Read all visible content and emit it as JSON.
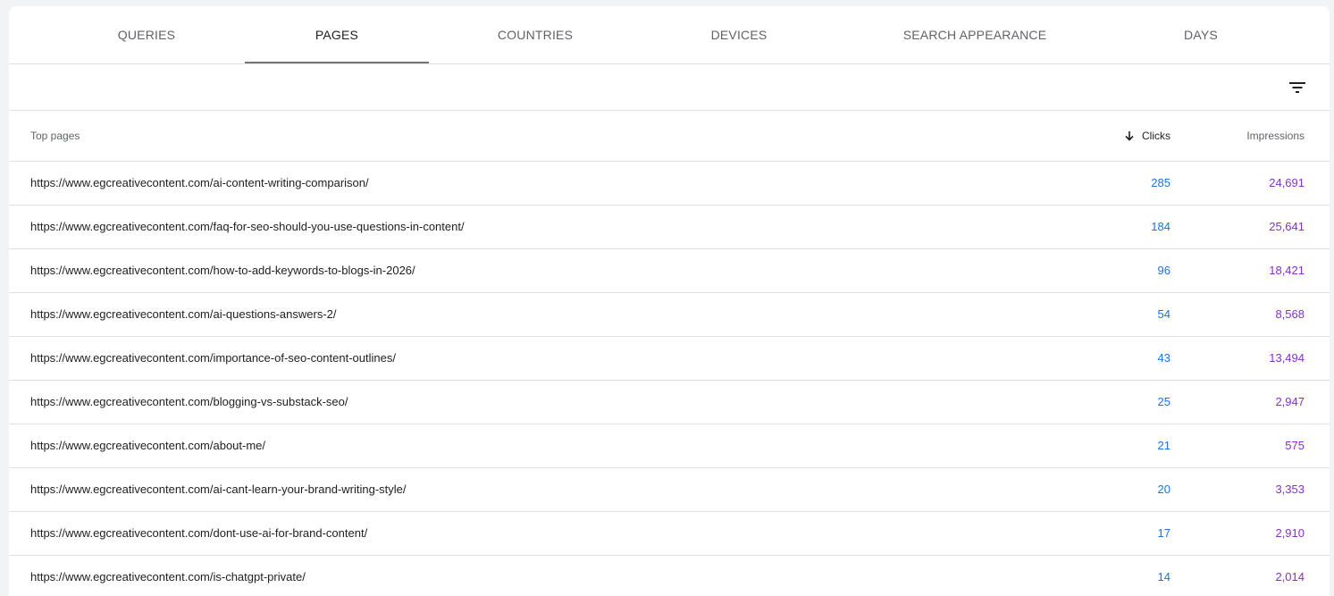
{
  "tabs": [
    {
      "label": "QUERIES"
    },
    {
      "label": "PAGES"
    },
    {
      "label": "COUNTRIES"
    },
    {
      "label": "DEVICES"
    },
    {
      "label": "SEARCH APPEARANCE"
    },
    {
      "label": "DAYS"
    }
  ],
  "active_tab": "PAGES",
  "toolbar": {
    "filter_icon": "filter-list-icon"
  },
  "table": {
    "headers": {
      "page": "Top pages",
      "clicks": "Clicks",
      "impressions": "Impressions"
    },
    "sort": {
      "column": "clicks",
      "direction": "descending",
      "icon": "arrow-down-icon"
    },
    "rows": [
      {
        "page": "https://www.egcreativecontent.com/ai-content-writing-comparison/",
        "clicks": "285",
        "impressions": "24,691"
      },
      {
        "page": "https://www.egcreativecontent.com/faq-for-seo-should-you-use-questions-in-content/",
        "clicks": "184",
        "impressions": "25,641"
      },
      {
        "page": "https://www.egcreativecontent.com/how-to-add-keywords-to-blogs-in-2026/",
        "clicks": "96",
        "impressions": "18,421"
      },
      {
        "page": "https://www.egcreativecontent.com/ai-questions-answers-2/",
        "clicks": "54",
        "impressions": "8,568"
      },
      {
        "page": "https://www.egcreativecontent.com/importance-of-seo-content-outlines/",
        "clicks": "43",
        "impressions": "13,494"
      },
      {
        "page": "https://www.egcreativecontent.com/blogging-vs-substack-seo/",
        "clicks": "25",
        "impressions": "2,947"
      },
      {
        "page": "https://www.egcreativecontent.com/about-me/",
        "clicks": "21",
        "impressions": "575"
      },
      {
        "page": "https://www.egcreativecontent.com/ai-cant-learn-your-brand-writing-style/",
        "clicks": "20",
        "impressions": "3,353"
      },
      {
        "page": "https://www.egcreativecontent.com/dont-use-ai-for-brand-content/",
        "clicks": "17",
        "impressions": "2,910"
      },
      {
        "page": "https://www.egcreativecontent.com/is-chatgpt-private/",
        "clicks": "14",
        "impressions": "2,014"
      }
    ]
  },
  "colors": {
    "clicks": "#1a73e8",
    "impressions": "#8430ce",
    "tab_indicator": "#757575",
    "divider": "#e0e0e0"
  }
}
